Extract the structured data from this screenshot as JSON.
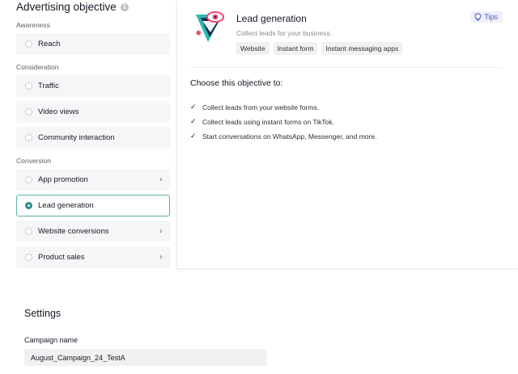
{
  "objective": {
    "title": "Advertising objective",
    "info_icon": "info-icon",
    "groups": [
      {
        "label": "Awareness",
        "options": [
          {
            "label": "Reach",
            "has_chevron": false,
            "selected": false
          }
        ]
      },
      {
        "label": "Consideration",
        "options": [
          {
            "label": "Traffic",
            "has_chevron": false,
            "selected": false
          },
          {
            "label": "Video views",
            "has_chevron": false,
            "selected": false
          },
          {
            "label": "Community interaction",
            "has_chevron": false,
            "selected": false
          }
        ]
      },
      {
        "label": "Conversion",
        "options": [
          {
            "label": "App promotion",
            "has_chevron": true,
            "selected": false
          },
          {
            "label": "Lead generation",
            "has_chevron": false,
            "selected": true
          },
          {
            "label": "Website conversions",
            "has_chevron": true,
            "selected": false
          },
          {
            "label": "Product sales",
            "has_chevron": true,
            "selected": false
          }
        ]
      }
    ]
  },
  "detail": {
    "title": "Lead generation",
    "subtitle": "Collect leads for your business.",
    "tags": [
      "Website",
      "Instant form",
      "Instant messaging apps"
    ],
    "tips_label": "Tips",
    "tips_icon": "lightbulb-icon",
    "choose_title": "Choose this objective to:",
    "benefits": [
      "Collect leads from your website forms.",
      "Collect leads using instant forms on TikTok.",
      "Start conversations on WhatsApp, Messenger, and more."
    ]
  },
  "settings": {
    "title": "Settings",
    "campaign_name_label": "Campaign name",
    "campaign_name_value": "August_Campaign_24_TestA"
  },
  "colors": {
    "selected_border": "#5fb0a7",
    "radio_checked": "#2c8d86",
    "tips_text": "#4c55c2",
    "tips_bg": "#eef0fb"
  }
}
